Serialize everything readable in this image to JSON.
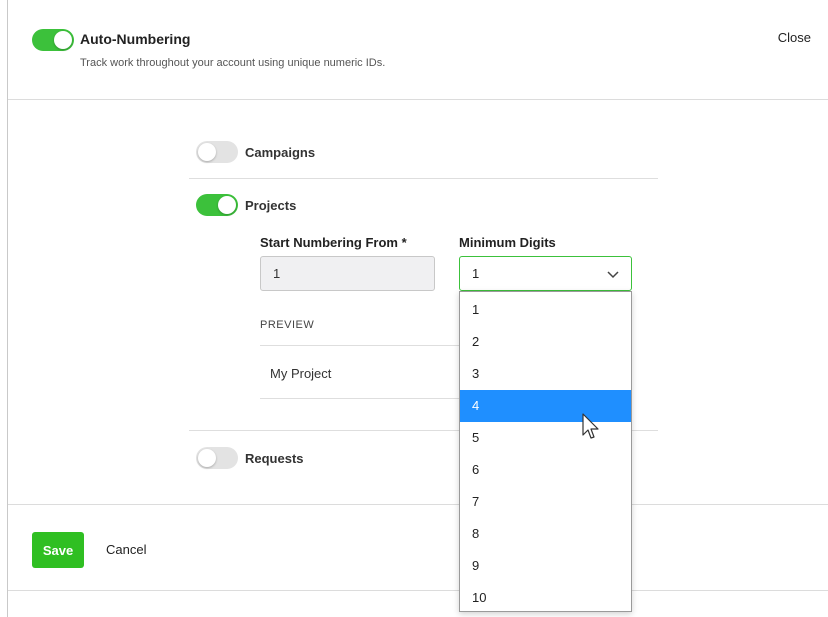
{
  "header": {
    "title": "Auto-Numbering",
    "description": "Track work throughout your account using unique numeric IDs.",
    "close_label": "Close",
    "enabled": true
  },
  "options": {
    "campaigns": {
      "label": "Campaigns",
      "enabled": false
    },
    "projects": {
      "label": "Projects",
      "enabled": true
    },
    "requests": {
      "label": "Requests",
      "enabled": false
    }
  },
  "projects_config": {
    "start_label": "Start Numbering From *",
    "start_value": "1",
    "digits_label": "Minimum Digits",
    "digits_value": "1",
    "preview_label": "PREVIEW",
    "preview_value": "My Project"
  },
  "dropdown": {
    "options": [
      "1",
      "2",
      "3",
      "4",
      "5",
      "6",
      "7",
      "8",
      "9",
      "10"
    ],
    "highlighted": "4"
  },
  "footer": {
    "save_label": "Save",
    "cancel_label": "Cancel"
  },
  "colors": {
    "toggle_on": "#3cc13b",
    "toggle_off": "#e3e3e3",
    "highlight": "#1f8fff",
    "save_button": "#2fbf22"
  }
}
